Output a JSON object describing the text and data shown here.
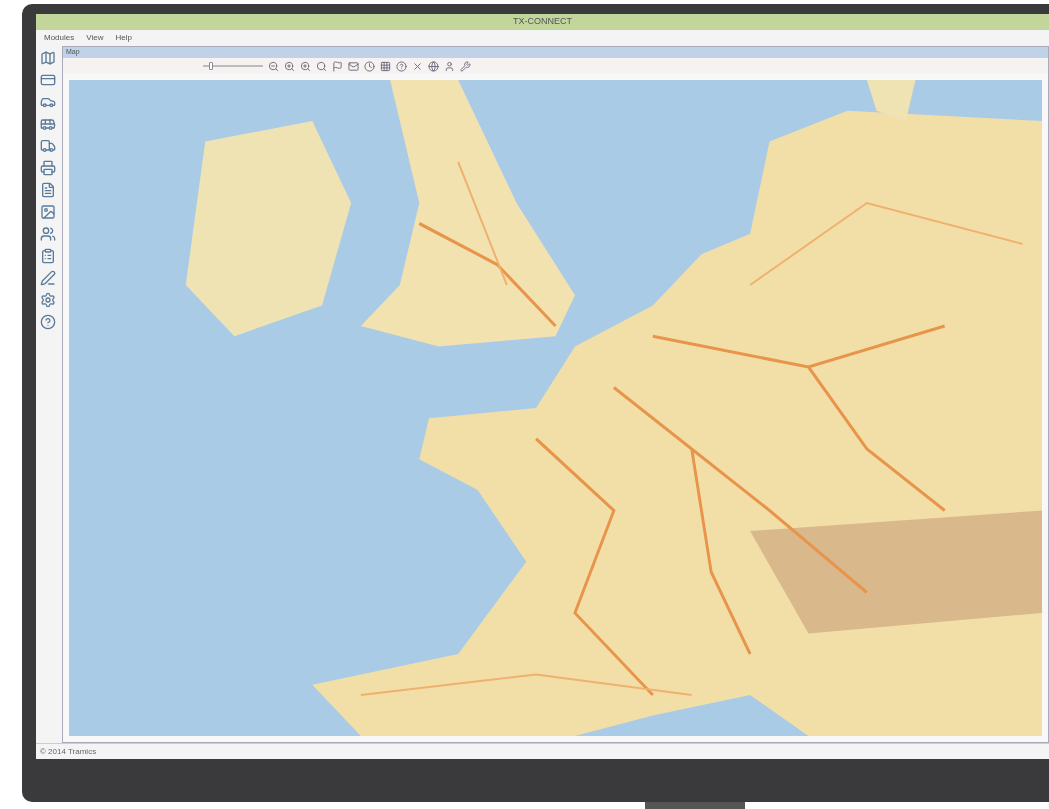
{
  "window": {
    "title": "TX-CONNECT"
  },
  "menu": [
    "Modules",
    "View",
    "Help"
  ],
  "panel": {
    "title": "Map"
  },
  "toolbar": {
    "zoom_slider": {
      "level": 0.1
    }
  },
  "status_bar": {
    "text": "© 2014 Tramics"
  }
}
